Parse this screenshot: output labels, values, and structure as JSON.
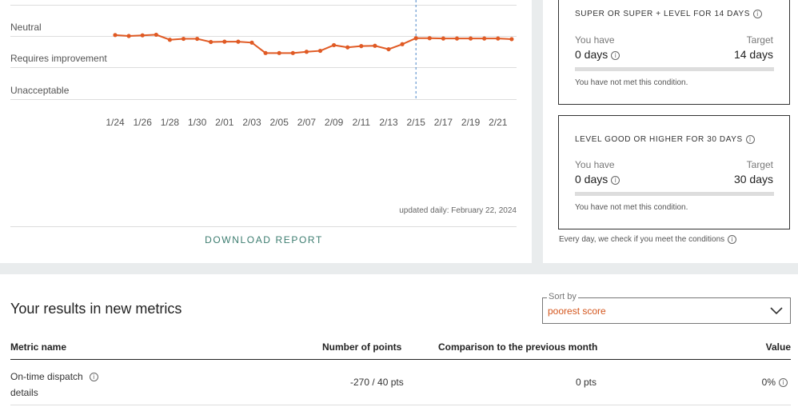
{
  "chart": {
    "y_levels": [
      "Neutral",
      "Requires improvement",
      "Unacceptable"
    ],
    "x_ticks": [
      "1/24",
      "1/26",
      "1/28",
      "1/30",
      "2/01",
      "2/03",
      "2/05",
      "2/07",
      "2/09",
      "2/11",
      "2/13",
      "2/15",
      "2/17",
      "2/19",
      "2/21"
    ],
    "updated": "updated daily: February 22, 2024",
    "download_label": "DOWNLOAD REPORT",
    "line_color": "#e05a24"
  },
  "chart_data": {
    "type": "line",
    "x": [
      "1/24",
      "1/25",
      "1/26",
      "1/27",
      "1/28",
      "1/29",
      "1/30",
      "1/31",
      "2/01",
      "2/02",
      "2/03",
      "2/04",
      "2/05",
      "2/06",
      "2/07",
      "2/08",
      "2/09",
      "2/10",
      "2/11",
      "2/12",
      "2/13",
      "2/14",
      "2/15",
      "2/16",
      "2/17",
      "2/18",
      "2/19",
      "2/20",
      "2/21",
      "2/22"
    ],
    "y_categories": [
      "Unacceptable",
      "Requires improvement",
      "Neutral"
    ],
    "ylim": [
      0,
      2
    ],
    "grid": true,
    "series": [
      {
        "values": [
          2.03,
          2.0,
          2.02,
          2.04,
          1.88,
          1.91,
          1.91,
          1.81,
          1.82,
          1.82,
          1.79,
          1.46,
          1.46,
          1.46,
          1.5,
          1.53,
          1.71,
          1.64,
          1.68,
          1.69,
          1.58,
          1.74,
          1.93,
          1.93,
          1.92,
          1.92,
          1.92,
          1.92,
          1.92,
          1.9
        ]
      }
    ],
    "vertical_marker_at": "2/15"
  },
  "conditions": [
    {
      "title": "SUPER OR SUPER + LEVEL FOR 14 DAYS",
      "have_label": "You have",
      "have_value": "0 days",
      "target_label": "Target",
      "target_value": "14 days",
      "progress": 0,
      "status": "You have not met this condition."
    },
    {
      "title": "LEVEL GOOD OR HIGHER FOR 30 DAYS",
      "have_label": "You have",
      "have_value": "0 days",
      "target_label": "Target",
      "target_value": "30 days",
      "progress": 0,
      "status": "You have not met this condition."
    }
  ],
  "everyday_note": "Every day, we check if you meet the conditions",
  "results": {
    "title": "Your results in new metrics",
    "sort_label": "Sort by",
    "sort_value": "poorest score",
    "columns": [
      "Metric name",
      "Number of points",
      "Comparison to the previous month",
      "Value"
    ],
    "rows": [
      {
        "name": "On-time dispatch",
        "details": "details",
        "points": "-270 / 40 pts",
        "comparison": "0 pts",
        "value": "0%"
      }
    ]
  },
  "info_glyph": "i"
}
